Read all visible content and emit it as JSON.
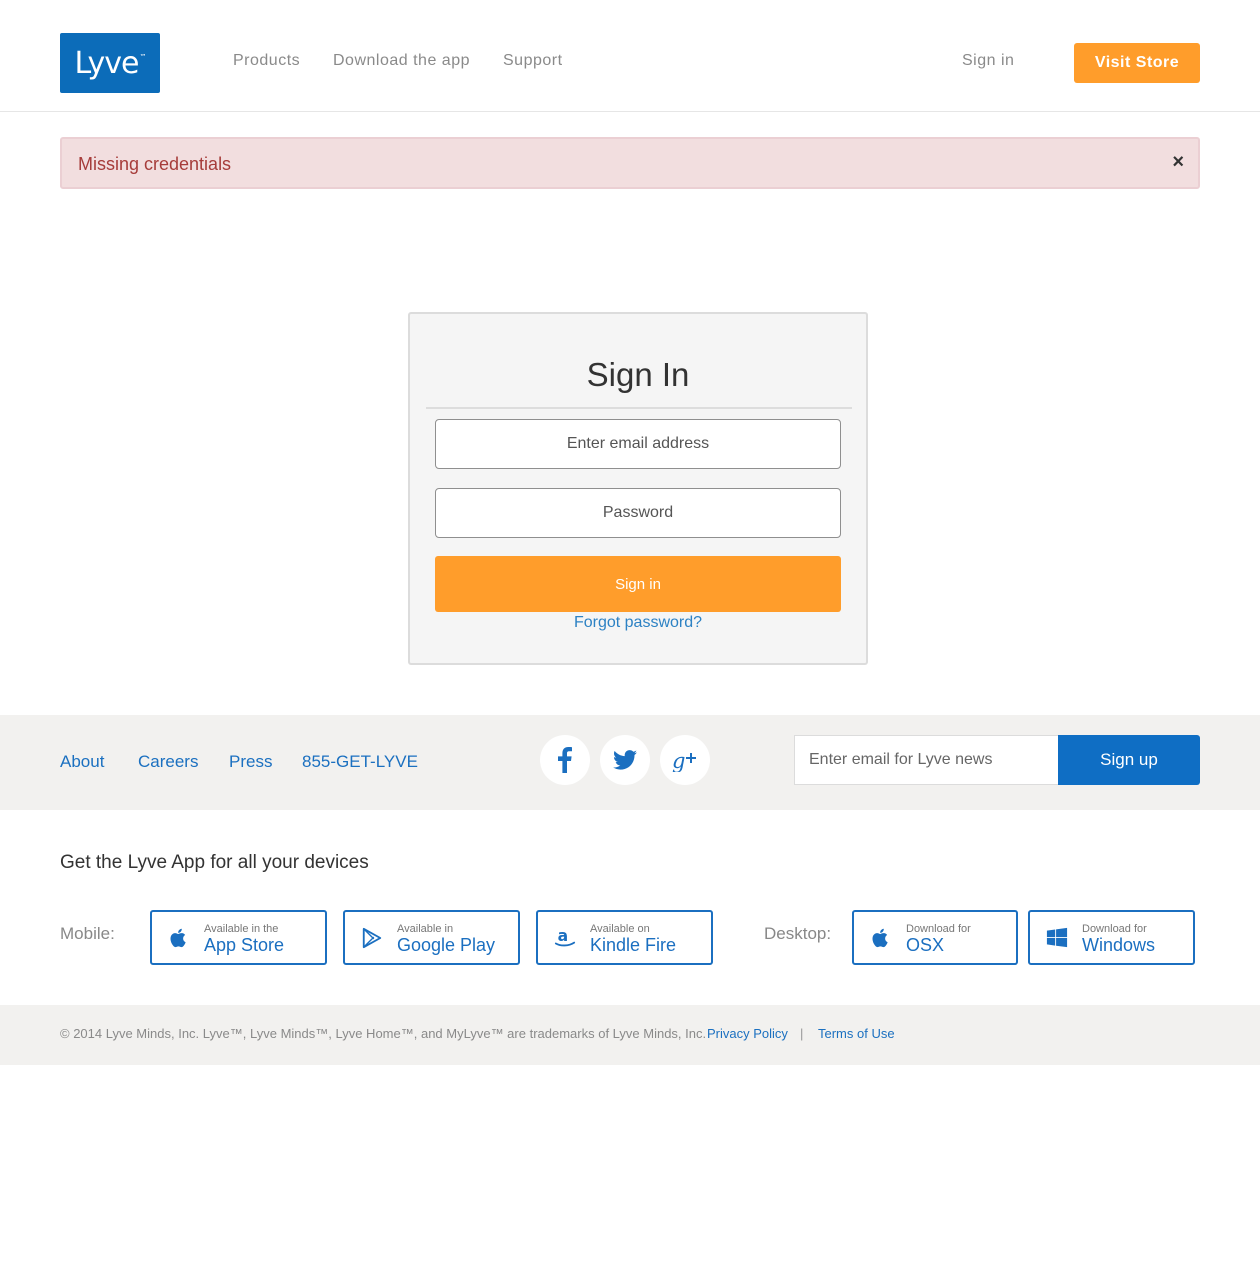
{
  "header": {
    "logo_text": "Lyve",
    "logo_tm": "™",
    "nav": [
      "Products",
      "Download the app",
      "Support"
    ],
    "sign_in": "Sign in",
    "visit_store": "Visit Store"
  },
  "alert": {
    "message": "Missing credentials",
    "close": "×"
  },
  "signin_card": {
    "title": "Sign In",
    "email_placeholder": "Enter email address",
    "password_placeholder": "Password",
    "submit": "Sign in",
    "forgot": "Forgot password?"
  },
  "footer": {
    "links": [
      "About",
      "Careers",
      "Press",
      "855-GET-LYVE"
    ],
    "social": [
      "facebook-icon",
      "twitter-icon",
      "google-plus-icon"
    ],
    "newsletter_placeholder": "Enter email for Lyve news",
    "signup": "Sign up"
  },
  "apps": {
    "heading": "Get the Lyve App for all your devices",
    "mobile_label": "Mobile:",
    "desktop_label": "Desktop:",
    "mobile": [
      {
        "small": "Available in the",
        "big": "App Store",
        "icon": "apple-icon"
      },
      {
        "small": "Available in",
        "big": "Google Play",
        "icon": "google-play-icon"
      },
      {
        "small": "Available on",
        "big": "Kindle Fire",
        "icon": "amazon-icon"
      }
    ],
    "desktop": [
      {
        "small": "Download for",
        "big": "OSX",
        "icon": "apple-icon"
      },
      {
        "small": "Download for",
        "big": "Windows",
        "icon": "windows-icon"
      }
    ]
  },
  "bottom": {
    "copyright": "© 2014 Lyve Minds, Inc. Lyve™, Lyve Minds™, Lyve Home™, and MyLyve™ are trademarks of Lyve Minds, Inc.",
    "privacy": "Privacy Policy",
    "separator": "|",
    "terms": "Terms of Use"
  },
  "colors": {
    "brand_blue": "#0c6cb9",
    "accent_orange": "#ff9d2b",
    "link_blue": "#1b70c0",
    "alert_bg": "#f2dedf",
    "alert_text": "#a63c3a"
  }
}
